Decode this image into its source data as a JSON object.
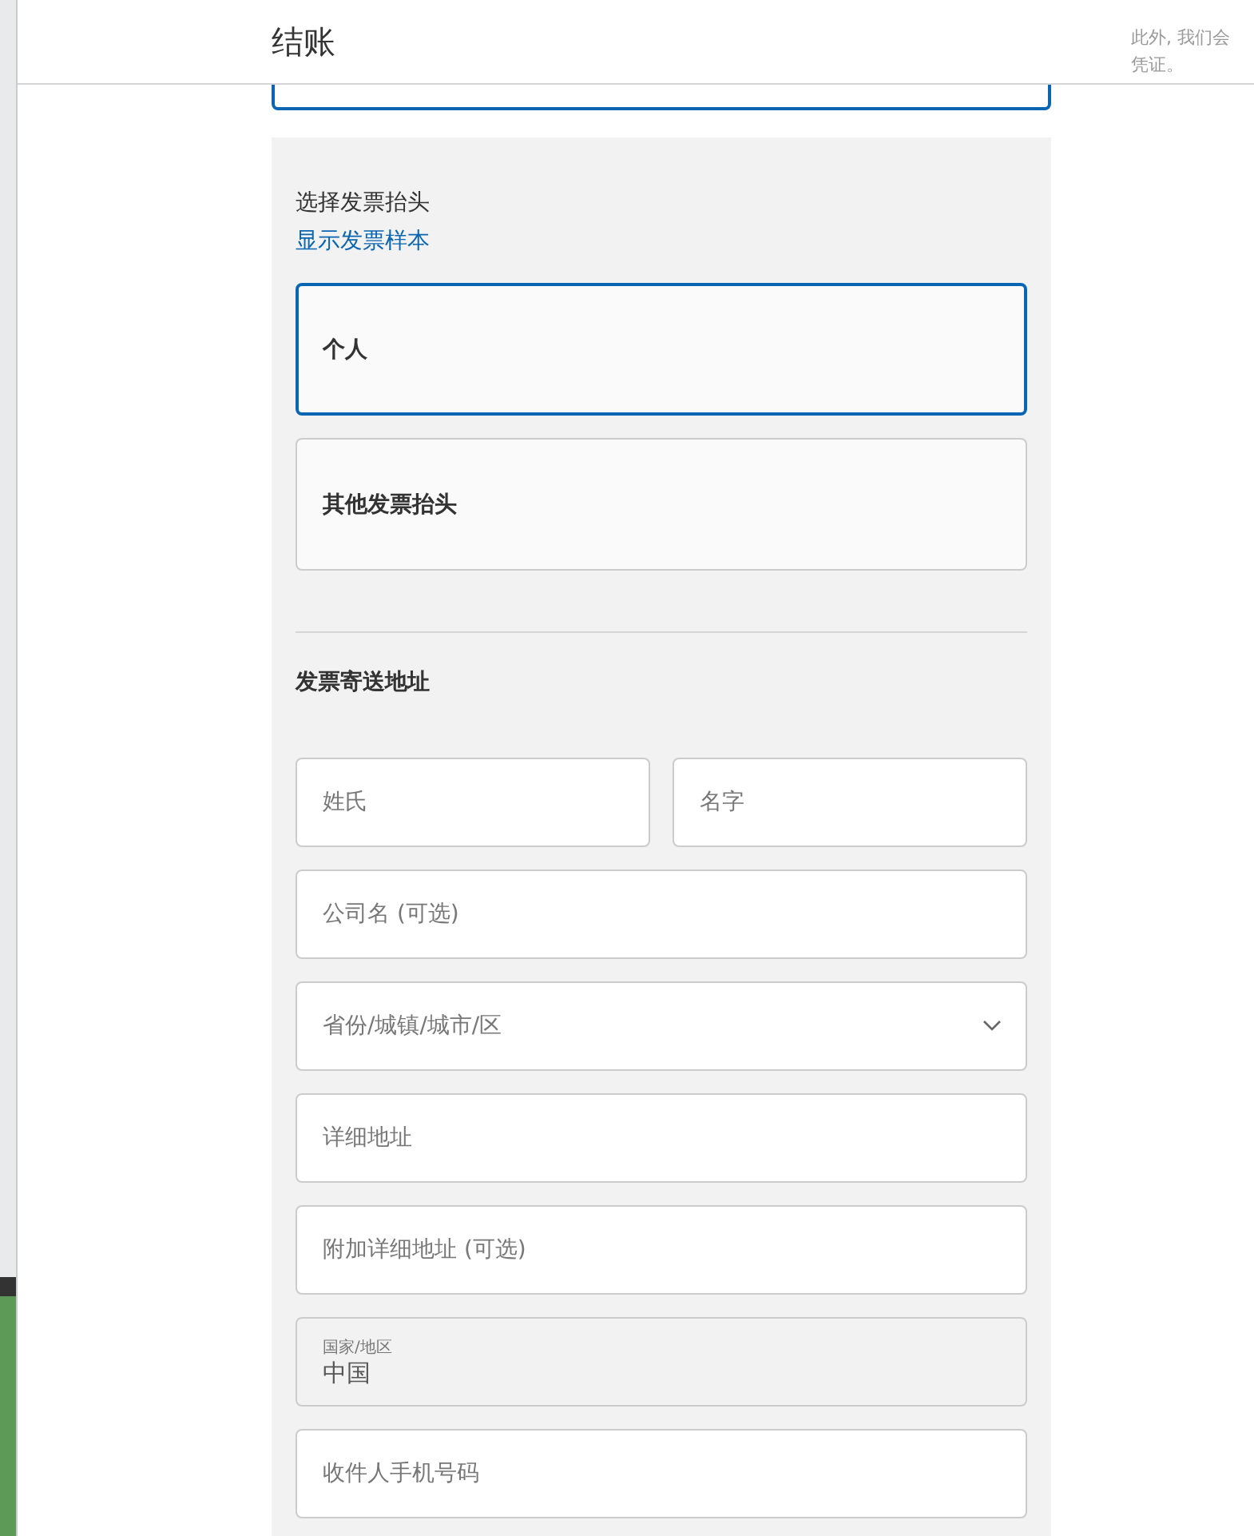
{
  "header": {
    "title": "结账"
  },
  "background_note": {
    "lines": [
      "此外, 我们会",
      "凭证。"
    ]
  },
  "previous_option": {
    "selected": true
  },
  "invoice_title": {
    "heading": "选择发票抬头",
    "sample_link": "显示发票样本",
    "options": [
      {
        "label": "个人",
        "selected": true
      },
      {
        "label": "其他发票抬头",
        "selected": false
      }
    ]
  },
  "shipping_address": {
    "heading": "发票寄送地址",
    "fields": [
      {
        "kind": "text",
        "placeholder": "姓氏",
        "half": true
      },
      {
        "kind": "text",
        "placeholder": "名字",
        "half": true
      },
      {
        "kind": "text",
        "placeholder": "公司名 (可选)"
      },
      {
        "kind": "select",
        "placeholder": "省份/城镇/城市/区"
      },
      {
        "kind": "text",
        "placeholder": "详细地址"
      },
      {
        "kind": "text",
        "placeholder": "附加详细地址 (可选)"
      },
      {
        "kind": "readonly",
        "label": "国家/地区",
        "value": "中国"
      },
      {
        "kind": "text",
        "placeholder": "收件人手机号码"
      }
    ]
  }
}
